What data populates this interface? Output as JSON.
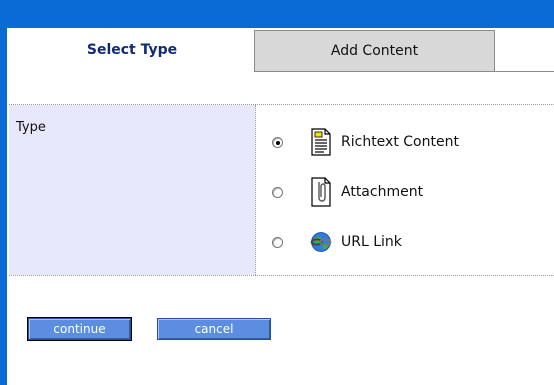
{
  "tabs": [
    {
      "label": "Select Type",
      "active": true
    },
    {
      "label": "Add Content",
      "active": false
    }
  ],
  "form": {
    "type_label": "Type",
    "options": [
      {
        "label": "Richtext Content",
        "icon": "document-icon",
        "selected": true
      },
      {
        "label": "Attachment",
        "icon": "paperclip-icon",
        "selected": false
      },
      {
        "label": "URL Link",
        "icon": "globe-link-icon",
        "selected": false
      }
    ]
  },
  "buttons": {
    "continue_label": "continue",
    "cancel_label": "cancel"
  },
  "colors": {
    "frame": "#0a6bd6",
    "tab_active_text": "#102a78",
    "label_cell": "#e8e8fc",
    "button": "#5b8ee0"
  }
}
